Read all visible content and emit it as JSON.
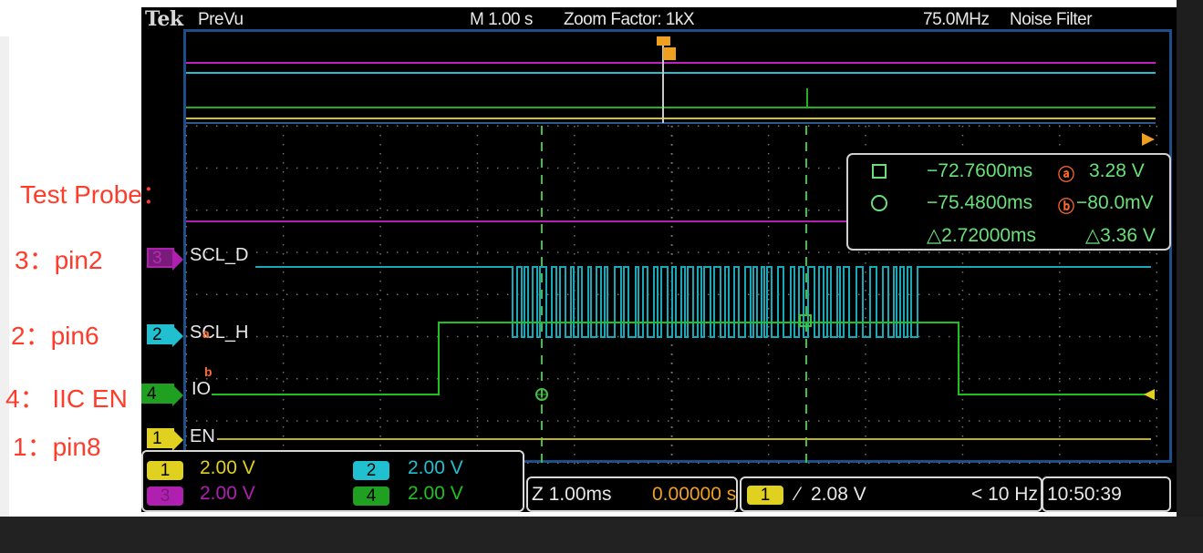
{
  "topbar": {
    "brand": "Tek",
    "mode": "PreVu",
    "timebase": "M 1.00 s",
    "zoom": "Zoom Factor: 1kX",
    "bandwidth": "75.0MHz",
    "filter": "Noise Filter"
  },
  "annotations": {
    "heading": "Test Probe：",
    "items": [
      "3：pin2",
      "2：pin6",
      "4：  IIC EN",
      "1：pin8"
    ]
  },
  "channels": [
    {
      "id": "3",
      "name": "SCL_D",
      "color": "#b020b0"
    },
    {
      "id": "2",
      "name": "SCL_H",
      "color": "#20c0d0"
    },
    {
      "id": "4",
      "name": "IO",
      "color": "#20a020"
    },
    {
      "id": "1",
      "name": "EN",
      "color": "#e0d020"
    }
  ],
  "cursor_readout": {
    "a_time": "−72.7600ms",
    "a_volt": "3.28 V",
    "b_time": "−75.4800ms",
    "b_volt": "−80.0mV",
    "dt": "△2.72000ms",
    "dv": "△3.36 V",
    "marker_a": "a",
    "marker_b": "b"
  },
  "scales": {
    "ch1": "2.00 V",
    "ch2": "2.00 V",
    "ch3": "2.00 V",
    "ch4": "2.00 V"
  },
  "horizontal": {
    "zoom_scale": "Z 1.00ms",
    "position": "0.00000 s"
  },
  "trigger": {
    "source": "1",
    "level": "2.08 V",
    "freq": "< 10 Hz"
  },
  "clock": "10:50:39",
  "colors": {
    "ch1": "#e0d020",
    "ch2": "#20c0d0",
    "ch3": "#b020b0",
    "ch4": "#20a020",
    "annotation": "#ff3b2a",
    "frame": "#1c4f8a",
    "cursor": "#6ae07a"
  }
}
